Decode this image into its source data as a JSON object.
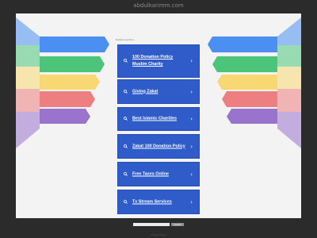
{
  "header": {
    "domain": "abdulkarimm.com"
  },
  "related": {
    "label": "Related searches"
  },
  "links": [
    {
      "label": "100 Donation Policy Muslim Charity"
    },
    {
      "label": "Giving Zakat"
    },
    {
      "label": "Best Islamic Charities"
    },
    {
      "label": "Zakat 100 Donation Policy"
    },
    {
      "label": "Free Taxes Online"
    },
    {
      "label": "Tv Stream Services"
    }
  ],
  "icons": {
    "link_icon": "search-icon",
    "link_arrow": "chevron-right-icon"
  },
  "footer": {
    "search_placeholder": "",
    "search_button": "Search",
    "privacy": "Privacy Policy"
  },
  "colors": {
    "page_bg": "#2b2b2b",
    "content_bg": "#f3f3f3",
    "card_bg": "#2f5cc9",
    "card_text": "#ffffff",
    "rainbow": [
      "#4c8ff2",
      "#4cc47a",
      "#f7d873",
      "#ee7f80",
      "#9a73cc"
    ]
  }
}
